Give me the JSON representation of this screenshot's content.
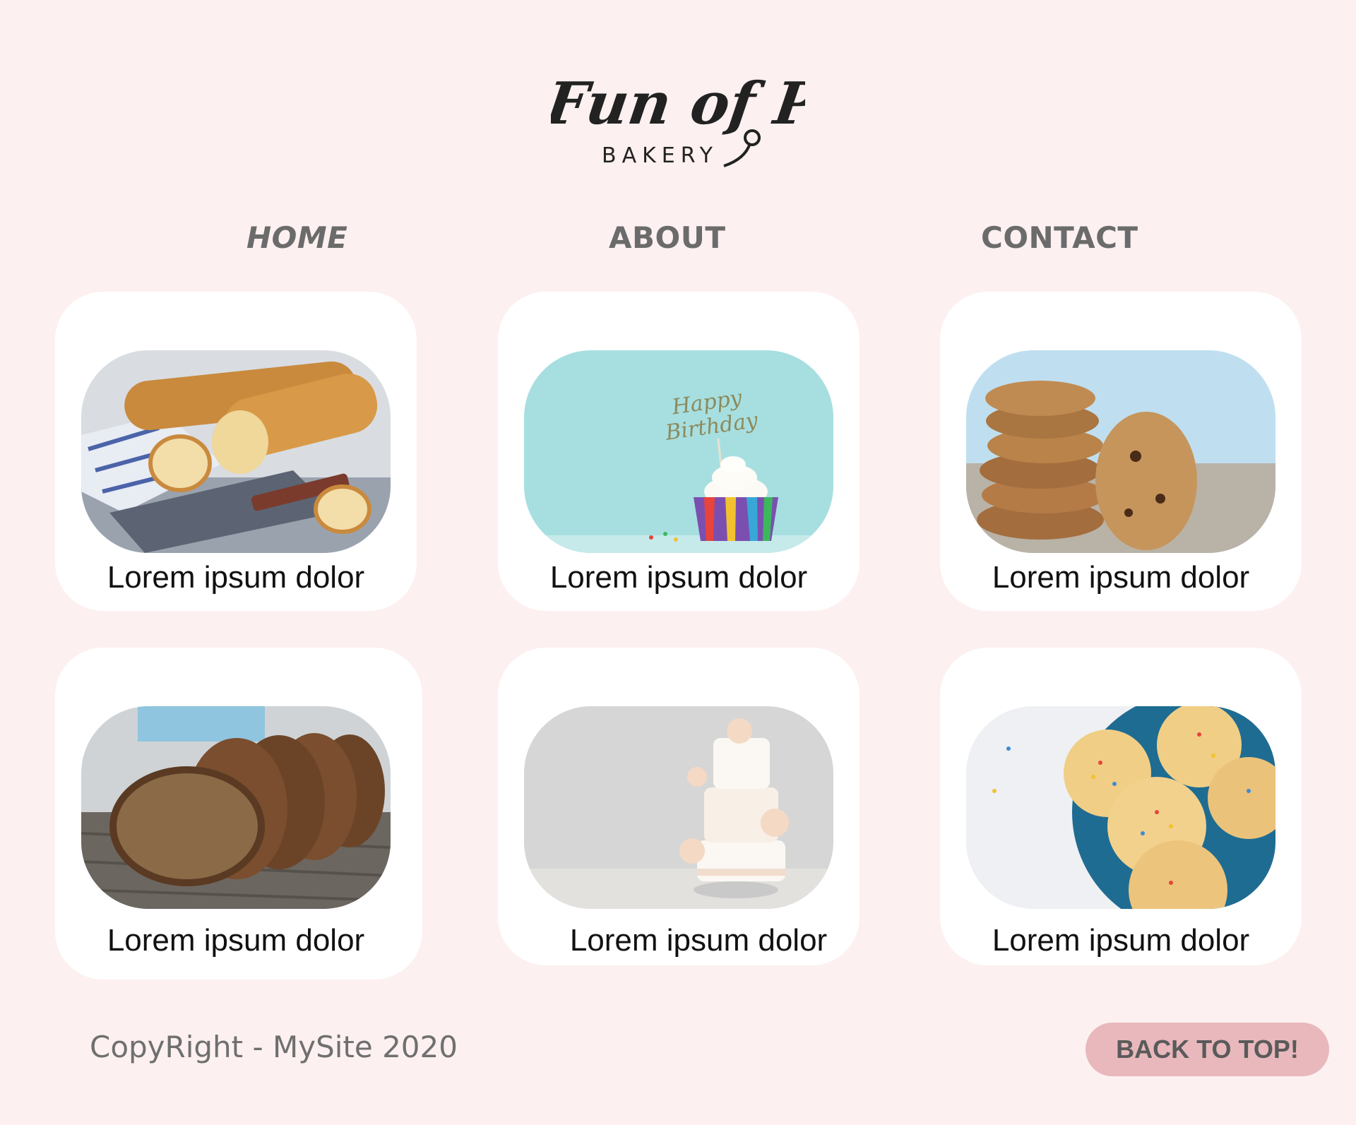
{
  "brand": {
    "name": "Fun of Pop",
    "tagline": "BAKERY"
  },
  "nav": {
    "items": [
      {
        "label": "HOME"
      },
      {
        "label": "ABOUT"
      },
      {
        "label": "CONTACT"
      }
    ]
  },
  "products": [
    {
      "label": "Lorem ipsum dolor",
      "image": "baguette-photo"
    },
    {
      "label": "Lorem ipsum dolor",
      "image": "birthday-cupcake-photo"
    },
    {
      "label": "Lorem ipsum dolor",
      "image": "cookie-stack-photo"
    },
    {
      "label": "Lorem ipsum dolor",
      "image": "sliced-rye-bread-photo"
    },
    {
      "label": "Lorem ipsum dolor",
      "image": "wedding-cake-photo"
    },
    {
      "label": "Lorem ipsum dolor",
      "image": "sprinkle-cookies-photo"
    }
  ],
  "footer": {
    "copyright": "CopyRight - MySite 2020",
    "back_to_top": "BACK TO TOP!"
  },
  "colors": {
    "background": "#fdf0f0",
    "card": "#ffffff",
    "nav_text": "#6b6b6b",
    "button": "#e8b8bc"
  }
}
